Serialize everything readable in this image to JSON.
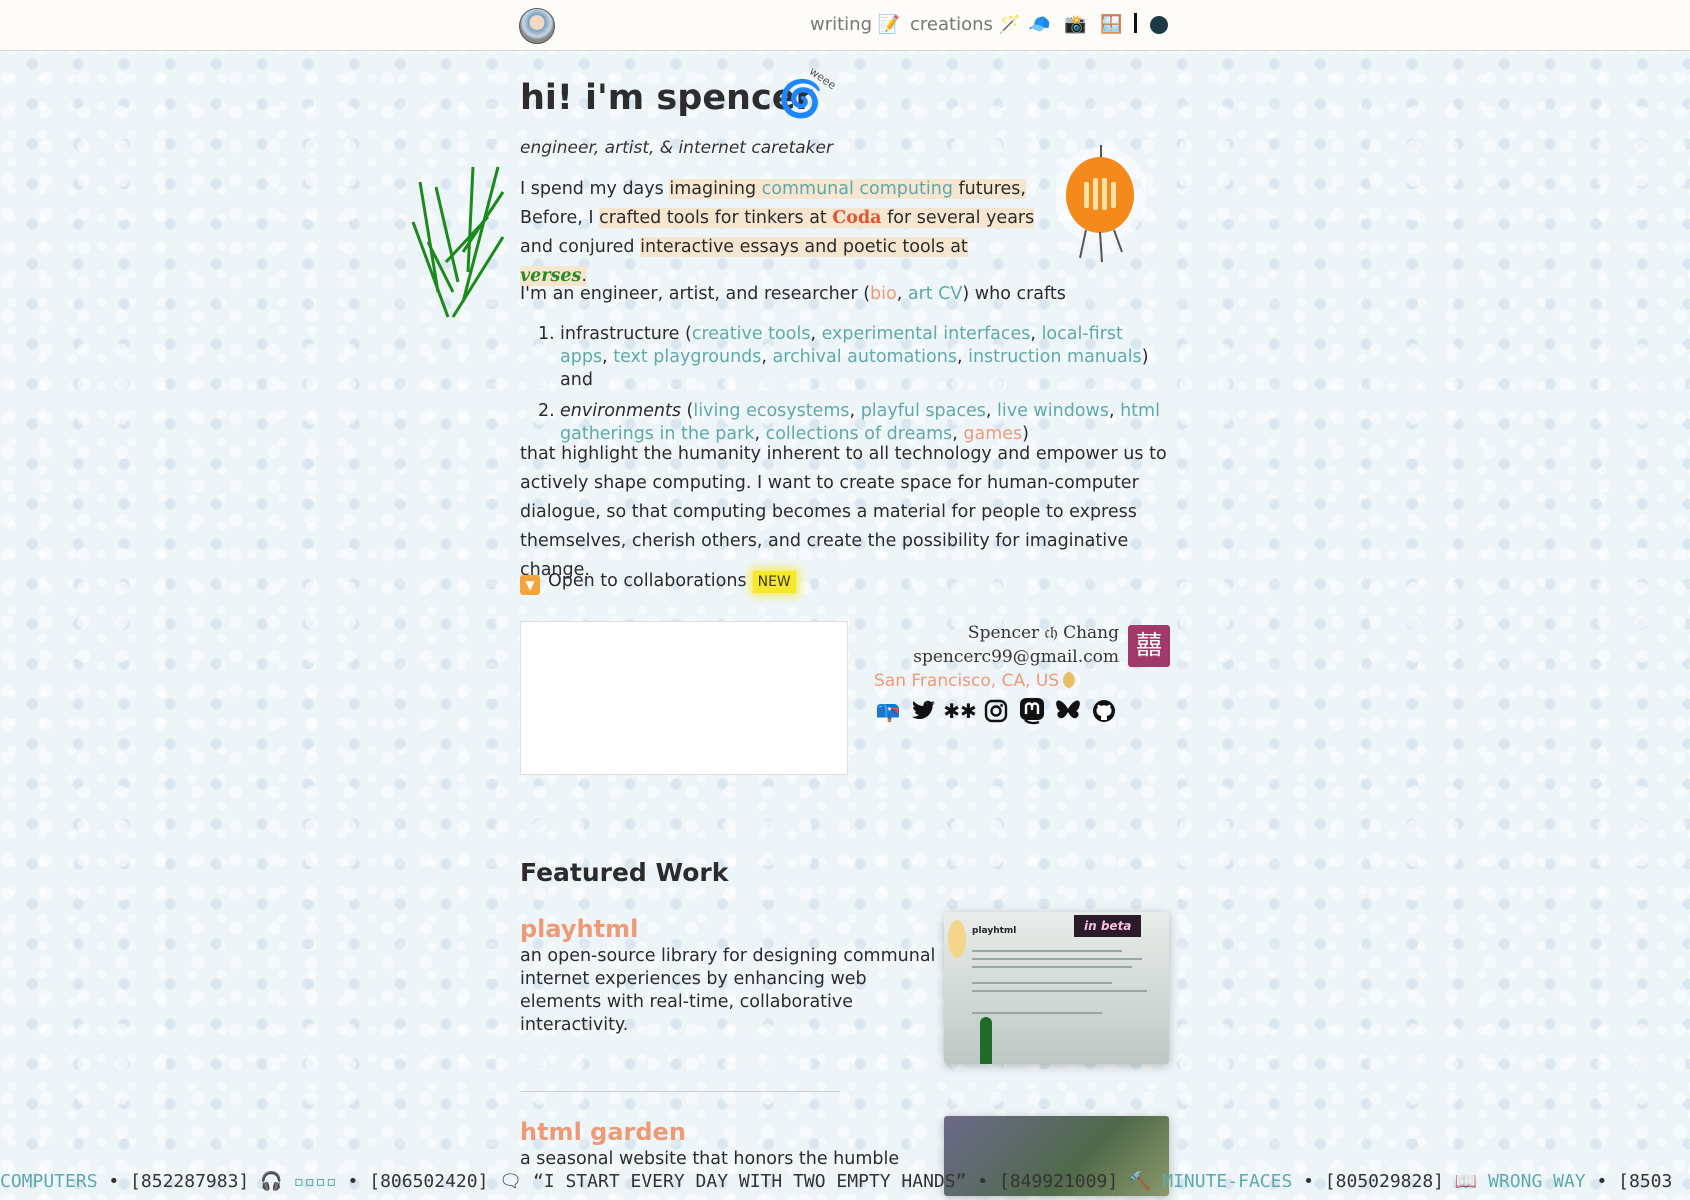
{
  "nav": {
    "writing": "writing 📝",
    "creations": "creations 🪄",
    "icons": [
      "cap-icon",
      "camera-icon",
      "window-icon"
    ]
  },
  "hero": {
    "title": "hi! i'm spencer",
    "weee": "weee",
    "tagline": "engineer, artist, & internet caretaker"
  },
  "intro": {
    "l1a": "I spend my days ",
    "l1b": "imagining",
    "l1c": "communal computing",
    "l1d": " futures,",
    "l2a": "Before, I ",
    "l2b": "crafted tools for tinkers",
    "l2c": " at ",
    "l2d": "Coda",
    "l2e": " for several years",
    "l3a": "and conjured ",
    "l3b": "interactive essays and poetic tools",
    "l3c": " at ",
    "l3d": "verses",
    "l3e": "."
  },
  "crafts": {
    "a": "I'm an engineer, artist, and researcher (",
    "bio": "bio",
    "sep": ", ",
    "cv": "art CV",
    "b": ") who crafts"
  },
  "list": {
    "item1": {
      "lead": "infrastructure (",
      "links": [
        "creative tools",
        "experimental interfaces",
        "local-first apps",
        "text playgrounds",
        "archival automations",
        "instruction manuals"
      ],
      "tail": ") and"
    },
    "item2": {
      "lead": "environments",
      "links": [
        "living ecosystems",
        "playful spaces",
        "live windows",
        "html gatherings in the park",
        "collections of dreams"
      ],
      "games": "games",
      "tail": ")"
    }
  },
  "mission": "that highlight the humanity inherent to all technology and empower us to actively shape computing. I want to create space for human-computer dialogue, so that computing becomes a material for people to express themselves, cherish others, and create the possibility for imaginative change.",
  "collab": {
    "label": "Open to collaborations",
    "badge": "NEW"
  },
  "contact": {
    "name": "Spencer 𝔠𝔥 Chang",
    "email": "spencerc99@gmail.com",
    "location": "San Francisco, CA, US",
    "seal": "囍",
    "socials": [
      "newsletter-icon",
      "twitter-icon",
      "are-na-icon",
      "instagram-icon",
      "mastodon-icon",
      "bluesky-icon",
      "github-icon"
    ]
  },
  "featured": {
    "heading": "Featured Work",
    "projects": [
      {
        "title": "playhtml",
        "desc": "an open-source library for designing communal internet experiences by enhancing web elements with real-time, collaborative interactivity.",
        "badge": "in beta",
        "mini_title": "playhtml"
      },
      {
        "title": "html garden",
        "desc": "a seasonal website that honors the humble html"
      }
    ]
  },
  "ticker": {
    "t1": "COMPUTERS",
    "t2": " • [852287983] 🎧 ",
    "t3": "▫▫▫▫",
    "t4": " • [806502420] 🗨 “I START EVERY DAY WITH TWO EMPTY HANDS” • [849921009] 🔨 ",
    "t5": "MINUTE-FACES",
    "t6": " • [805029828] 📖 ",
    "t7": "WRONG WAY",
    "t8": " • [8503"
  }
}
